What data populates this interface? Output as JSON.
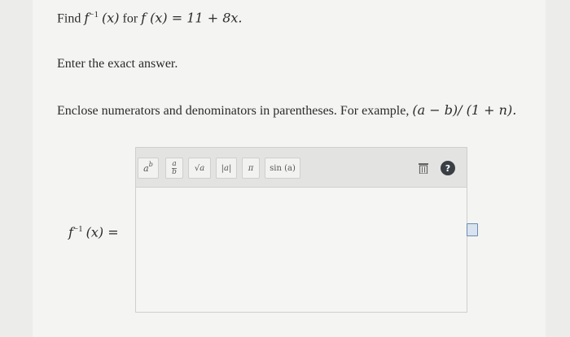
{
  "question": {
    "find_prefix": "Find ",
    "f_inv": "f",
    "inv_exp": "−1",
    "paren_x": "(x)",
    "for_text": " for ",
    "f_def": "f (x) = 11 + 8x.",
    "instruction": "Enter the exact answer.",
    "hint_text": "Enclose numerators and denominators in parentheses. For example, ",
    "hint_example": "(a − b)/ (1 + n)."
  },
  "editor": {
    "toolbar": {
      "power_label": "a",
      "power_exp": "b",
      "frac_num": "a",
      "frac_den": "b",
      "sqrt_label": "√a",
      "abs_label": "|a|",
      "pi_label": "π",
      "sin_label": "sin (a)",
      "help_label": "?"
    },
    "lhs_f": "f",
    "lhs_exp": "−1",
    "lhs_rest": "(x) ="
  },
  "colors": {
    "help_bg": "#3a3f46",
    "page_bg": "#f4f4f2"
  }
}
